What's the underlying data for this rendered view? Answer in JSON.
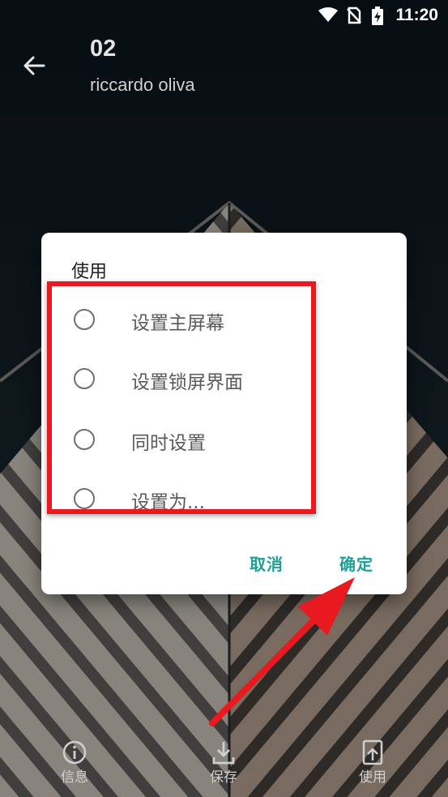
{
  "status_bar": {
    "time": "11:20",
    "icons": [
      "wifi-icon",
      "no-sim-icon",
      "battery-charging-icon"
    ]
  },
  "header": {
    "title": "02",
    "subtitle": "riccardo oliva"
  },
  "dialog": {
    "title": "使用",
    "options": [
      {
        "label": "设置主屏幕",
        "selected": false
      },
      {
        "label": "设置锁屏界面",
        "selected": false
      },
      {
        "label": "同时设置",
        "selected": false
      },
      {
        "label": "设置为...",
        "selected": false
      }
    ],
    "cancel_label": "取消",
    "confirm_label": "确定"
  },
  "bottom_nav": [
    {
      "label": "信息",
      "icon": "info-icon"
    },
    {
      "label": "保存",
      "icon": "download-icon"
    },
    {
      "label": "使用",
      "icon": "apply-wallpaper-icon"
    }
  ],
  "colors": {
    "accent": "#1f9f95",
    "annotation": "#e8191f",
    "dialog_bg": "#ffffff"
  }
}
